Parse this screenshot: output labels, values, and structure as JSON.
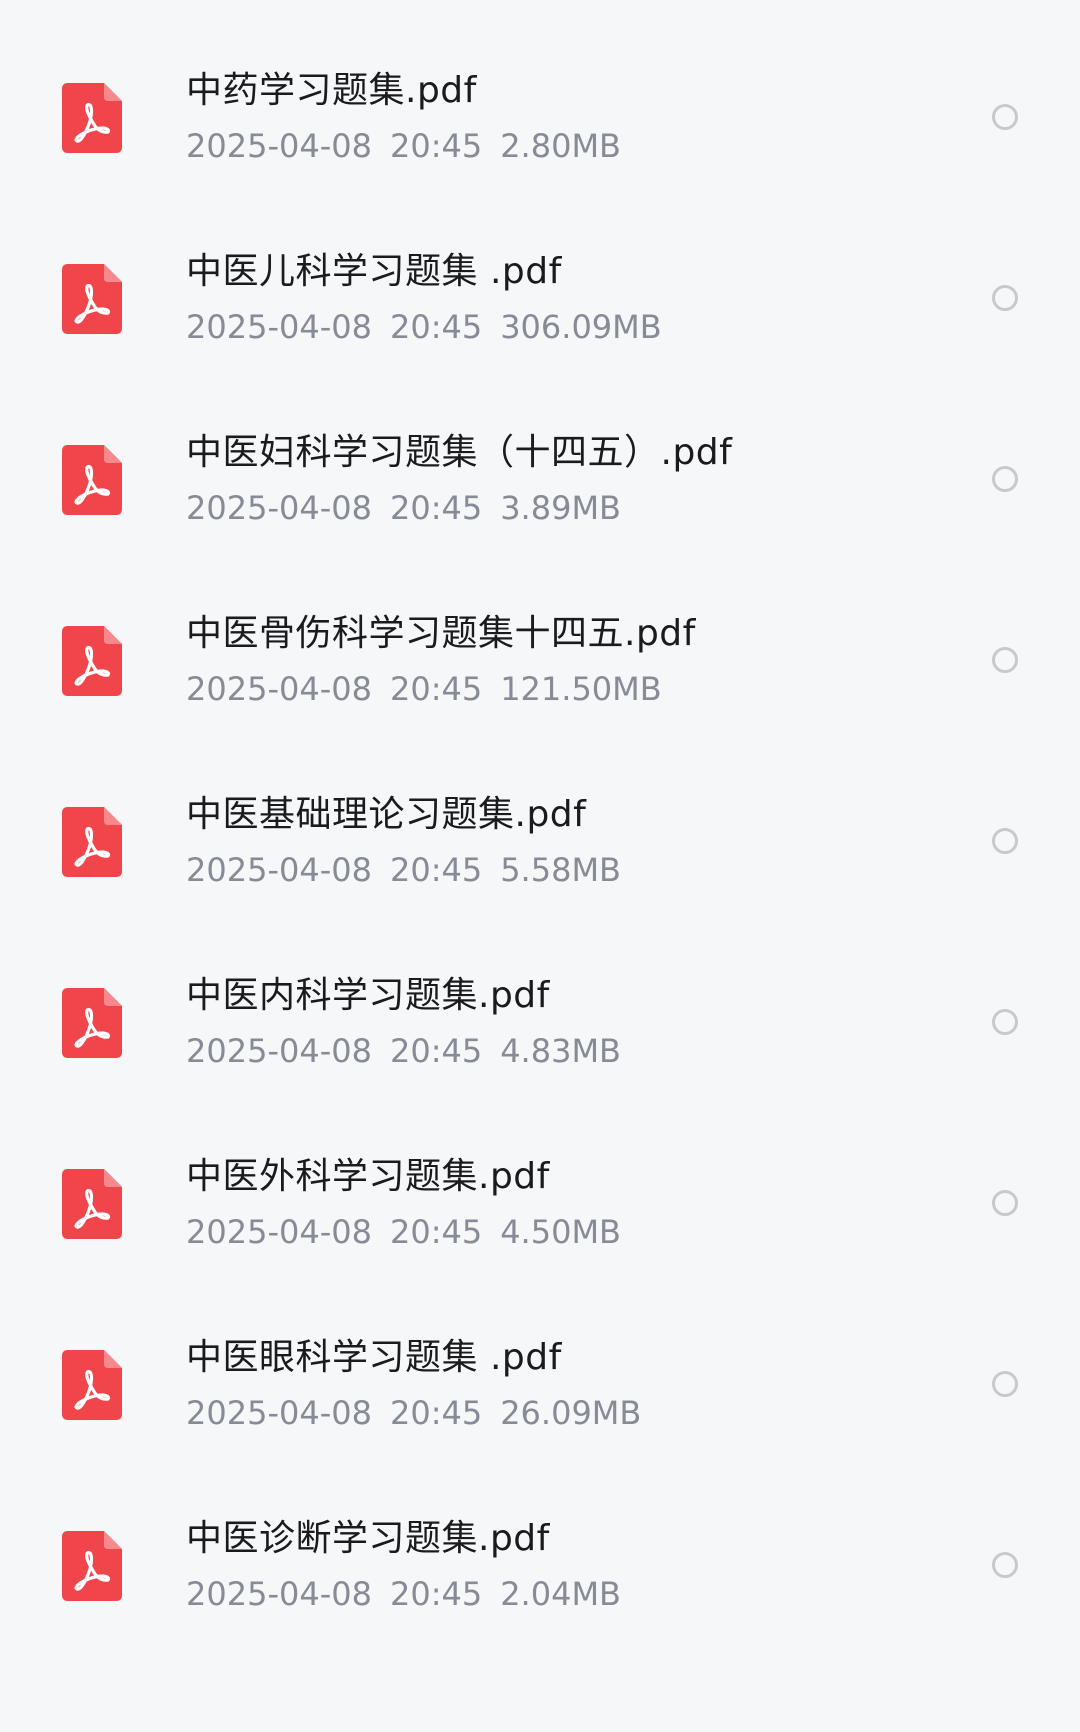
{
  "colors": {
    "background": "#f6f7f9",
    "pdf_icon_red": "#f0464b",
    "file_name_text": "#1b1b1d",
    "meta_text": "#878b96",
    "radio_border": "#c7c9cd"
  },
  "files": [
    {
      "name": "中药学习题集.pdf",
      "date": "2025-04-08",
      "time": "20:45",
      "size": "2.80MB",
      "icon": "pdf-icon",
      "selected": false
    },
    {
      "name": "中医儿科学习题集 .pdf",
      "date": "2025-04-08",
      "time": "20:45",
      "size": "306.09MB",
      "icon": "pdf-icon",
      "selected": false
    },
    {
      "name": "中医妇科学习题集（十四五）.pdf",
      "date": "2025-04-08",
      "time": "20:45",
      "size": "3.89MB",
      "icon": "pdf-icon",
      "selected": false
    },
    {
      "name": "中医骨伤科学习题集十四五.pdf",
      "date": "2025-04-08",
      "time": "20:45",
      "size": "121.50MB",
      "icon": "pdf-icon",
      "selected": false
    },
    {
      "name": "中医基础理论习题集.pdf",
      "date": "2025-04-08",
      "time": "20:45",
      "size": "5.58MB",
      "icon": "pdf-icon",
      "selected": false
    },
    {
      "name": "中医内科学习题集.pdf",
      "date": "2025-04-08",
      "time": "20:45",
      "size": "4.83MB",
      "icon": "pdf-icon",
      "selected": false
    },
    {
      "name": "中医外科学习题集.pdf",
      "date": "2025-04-08",
      "time": "20:45",
      "size": "4.50MB",
      "icon": "pdf-icon",
      "selected": false
    },
    {
      "name": "中医眼科学习题集 .pdf",
      "date": "2025-04-08",
      "time": "20:45",
      "size": "26.09MB",
      "icon": "pdf-icon",
      "selected": false
    },
    {
      "name": "中医诊断学习题集.pdf",
      "date": "2025-04-08",
      "time": "20:45",
      "size": "2.04MB",
      "icon": "pdf-icon",
      "selected": false
    }
  ]
}
